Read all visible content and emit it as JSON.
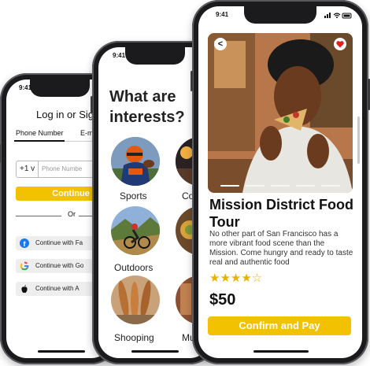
{
  "login": {
    "time": "9:41",
    "title": "Log in or Sig",
    "tab_phone": "Phone Number",
    "tab_email": "E-m",
    "country_code": "+1 v",
    "phone_placeholder": "Phone Numbe",
    "continue_label": "Continue",
    "or_label": "Or",
    "facebook_label": "Continue with Fa",
    "google_label": "Continue with Go",
    "apple_label": "Continue with A"
  },
  "interests": {
    "time": "9:41",
    "heading_line1": "What are",
    "heading_line2": "interests?",
    "items": [
      {
        "label": "Sports"
      },
      {
        "label": "Co"
      },
      {
        "label": "Outdoors"
      },
      {
        "label": "Shooping"
      },
      {
        "label": "Mu"
      }
    ]
  },
  "detail": {
    "time": "9:41",
    "back_icon": "back-arrow-icon",
    "favorite_icon": "heart-icon",
    "title": "Mission District Food Tour",
    "description": "No other part of San Francisco has a more vibrant food scene than the Mission. Come hungry and ready to taste real and authentic food",
    "rating": 4,
    "rating_max": 5,
    "stars_text": "★★★★☆",
    "price": "$50",
    "cta_label": "Confirm and Pay"
  },
  "colors": {
    "accent": "#f2c200",
    "star": "#e5b300",
    "frame": "#1b1b1d"
  }
}
